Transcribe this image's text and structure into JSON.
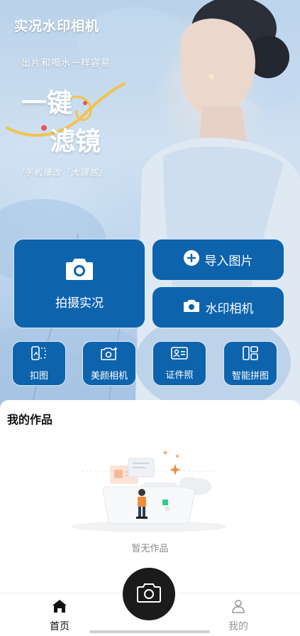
{
  "hero": {
    "app_title": "实况水印相机",
    "tagline": "出片和喝水一样容易",
    "headline_line1": "一键",
    "headline_line2": "滤镜",
    "sub_tagline": "/手机爆改「大疆感」"
  },
  "actions": {
    "capture_live": "拍摄实况",
    "import_image": "导入图片",
    "watermark_camera": "水印相机"
  },
  "tools": [
    {
      "label": "扣图",
      "icon": "cutout-icon"
    },
    {
      "label": "美颜相机",
      "icon": "beauty-camera-icon"
    },
    {
      "label": "证件照",
      "icon": "id-card-icon"
    },
    {
      "label": "智能拼图",
      "icon": "collage-icon"
    }
  ],
  "works": {
    "title": "我的作品",
    "empty_text": "暂无作品"
  },
  "nav": {
    "home": "首页",
    "me": "我的"
  },
  "colors": {
    "accent_blue": "#0e63ad",
    "fab_dark": "#1b1b1b",
    "muted_text": "#8a8a8a"
  }
}
